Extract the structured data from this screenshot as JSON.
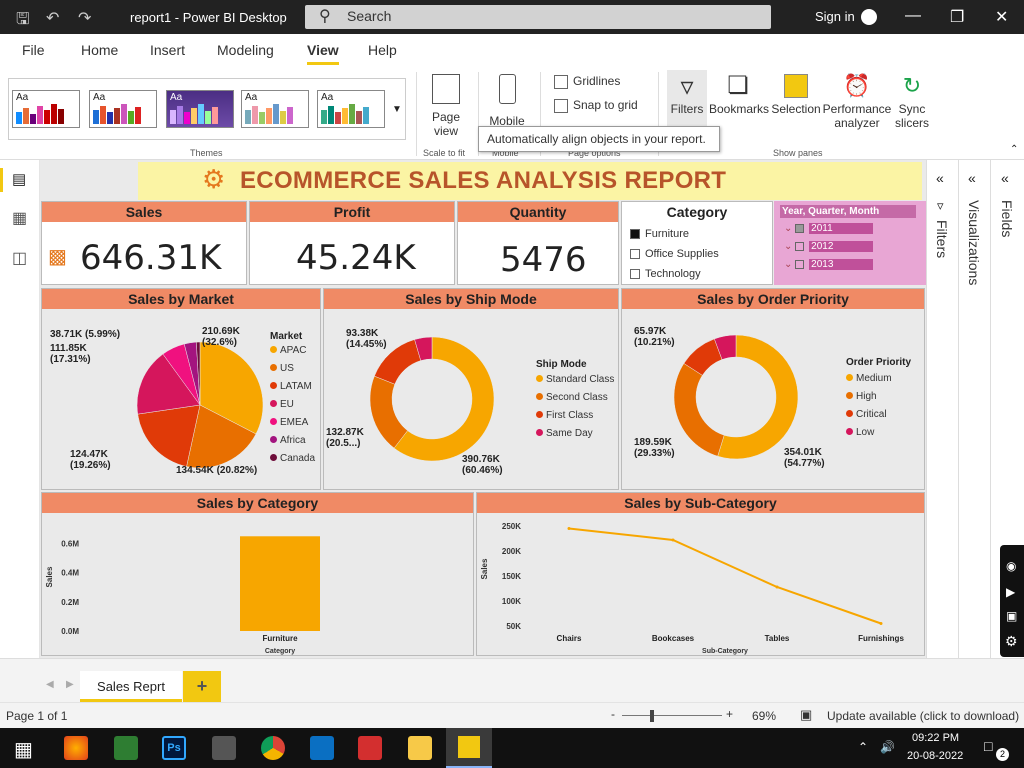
{
  "window": {
    "title": "report1 - Power BI Desktop",
    "search_placeholder": "Search",
    "signin": "Sign in"
  },
  "menu": [
    "File",
    "Home",
    "Insert",
    "Modeling",
    "View",
    "Help"
  ],
  "ribbon": {
    "themes_label": "Themes",
    "page_view": "Page view",
    "scale_to_fit": "Scale to fit",
    "mobile": "Mobile",
    "mobile_group": "Mobile",
    "gridlines": "Gridlines",
    "snap_to_grid": "Snap to grid",
    "page_options": "Page options",
    "filters": "Filters",
    "bookmarks": "Bookmarks",
    "selection": "Selection",
    "performance": "Performance analyzer",
    "sync": "Sync slicers",
    "show_panes": "Show panes",
    "tooltip": "Automatically align objects in your report.",
    "theme_swatch": "Aa"
  },
  "report": {
    "title": "ECOMMERCE SALES ANALYSIS REPORT",
    "kpis": [
      {
        "label": "Sales",
        "value": "646.31K"
      },
      {
        "label": "Profit",
        "value": "45.24K"
      },
      {
        "label": "Quantity",
        "value": "5476"
      }
    ],
    "category_slicer": {
      "title": "Category",
      "items": [
        "Furniture",
        "Office Supplies",
        "Technology"
      ],
      "checked": [
        true,
        false,
        false
      ]
    },
    "year_slicer": {
      "title": "Year, Quarter, Month",
      "items": [
        "2011",
        "2012",
        "2013"
      ]
    }
  },
  "charts": {
    "market": {
      "title": "Sales by Market",
      "legend_title": "Market",
      "labels": {
        "apac": "210.69K\n(32.6%)",
        "canada_top": "38.71K (5.99%)",
        "eu": "111.85K\n(17.31%)",
        "latam": "124.47K\n(19.26%)",
        "us": "134.54K (20.82%)"
      }
    },
    "ship": {
      "title": "Sales by Ship Mode",
      "legend_title": "Ship Mode",
      "labels": {
        "a": "93.38K\n(14.45%)",
        "b": "132.87K\n(20.5...)",
        "c": "390.76K\n(60.46%)"
      }
    },
    "priority": {
      "title": "Sales by Order Priority",
      "legend_title": "Order Priority",
      "labels": {
        "a": "65.97K\n(10.21%)",
        "b": "189.59K\n(29.33%)",
        "c": "354.01K\n(54.77%)"
      }
    },
    "category": {
      "title": "Sales by Category"
    },
    "subcategory": {
      "title": "Sales by Sub-Category"
    }
  },
  "chart_data": [
    {
      "type": "pie",
      "title": "Sales by Market",
      "categories": [
        "APAC",
        "US",
        "LATAM",
        "EU",
        "EMEA",
        "Africa",
        "Canada"
      ],
      "values": [
        210.69,
        134.54,
        124.47,
        111.85,
        38.71,
        20.0,
        6.0
      ],
      "colors": [
        "#f7a600",
        "#e86f00",
        "#e03a08",
        "#d5165c",
        "#f0117f",
        "#a3147f",
        "#6e0d3a"
      ]
    },
    {
      "type": "pie",
      "title": "Sales by Ship Mode",
      "categories": [
        "Standard Class",
        "Second Class",
        "First Class",
        "Same Day"
      ],
      "values": [
        390.76,
        132.87,
        93.38,
        29.3
      ],
      "colors": [
        "#f7a600",
        "#e86f00",
        "#e03a08",
        "#d5165c"
      ]
    },
    {
      "type": "pie",
      "title": "Sales by Order Priority",
      "categories": [
        "Medium",
        "High",
        "Critical",
        "Low"
      ],
      "values": [
        354.01,
        189.59,
        65.97,
        36.7
      ],
      "colors": [
        "#f7a600",
        "#e86f00",
        "#e03a08",
        "#d5165c"
      ]
    },
    {
      "type": "bar",
      "title": "Sales by Category",
      "categories": [
        "Furniture"
      ],
      "values": [
        0.65
      ],
      "xlabel": "Category",
      "ylabel": "Sales",
      "yticks": [
        "0.0M",
        "0.2M",
        "0.4M",
        "0.6M"
      ],
      "ylim": [
        0,
        0.7
      ]
    },
    {
      "type": "line",
      "title": "Sales by Sub-Category",
      "categories": [
        "Chairs",
        "Bookcases",
        "Tables",
        "Furnishings"
      ],
      "values": [
        245,
        222,
        128,
        55
      ],
      "xlabel": "Sub-Category",
      "ylabel": "Sales",
      "yticks": [
        "50K",
        "100K",
        "150K",
        "200K",
        "250K"
      ],
      "ylim": [
        40,
        260
      ]
    }
  ],
  "panes": {
    "filters": "Filters",
    "visualizations": "Visualizations",
    "fields": "Fields"
  },
  "pages": {
    "tab": "Sales Reprt",
    "add": "+"
  },
  "status": {
    "page": "Page 1 of 1",
    "zoom": "69%",
    "update": "Update available (click to download)"
  },
  "taskbar": {
    "time": "09:22 PM",
    "date": "20-08-2022",
    "notifications": "2"
  }
}
